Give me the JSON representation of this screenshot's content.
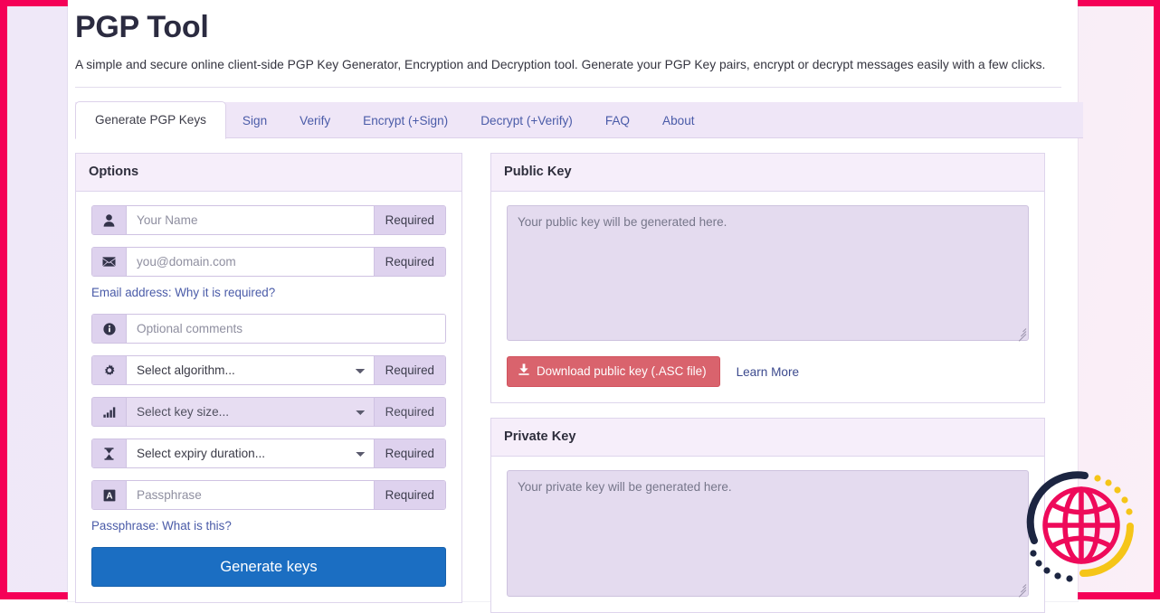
{
  "page": {
    "title": "PGP Tool",
    "subtitle": "A simple and secure online client-side PGP Key Generator, Encryption and Decryption tool. Generate your PGP Key pairs, encrypt or decrypt messages easily with a few clicks.",
    "frame_color": "#f50057",
    "background_color": "#efe8f8"
  },
  "tabs": [
    {
      "label": "Generate PGP Keys",
      "active": true
    },
    {
      "label": "Sign",
      "active": false
    },
    {
      "label": "Verify",
      "active": false
    },
    {
      "label": "Encrypt (+Sign)",
      "active": false
    },
    {
      "label": "Decrypt (+Verify)",
      "active": false
    },
    {
      "label": "FAQ",
      "active": false
    },
    {
      "label": "About",
      "active": false
    }
  ],
  "options_panel": {
    "title": "Options",
    "fields": {
      "name": {
        "icon": "user-icon",
        "placeholder": "Your Name",
        "value": "",
        "addon": "Required"
      },
      "email": {
        "icon": "envelope-icon",
        "placeholder": "you@domain.com",
        "value": "",
        "addon": "Required"
      },
      "email_help": "Email address: Why it is required?",
      "comments": {
        "icon": "info-icon",
        "placeholder": "Optional comments",
        "value": "",
        "addon": ""
      },
      "algorithm": {
        "icon": "gear-icon",
        "placeholder": "Select algorithm...",
        "addon": "Required",
        "disabled": false
      },
      "keysize": {
        "icon": "signal-bars-icon",
        "placeholder": "Select key size...",
        "addon": "Required",
        "disabled": true
      },
      "expiry": {
        "icon": "hourglass-icon",
        "placeholder": "Select expiry duration...",
        "addon": "Required",
        "disabled": false
      },
      "passphrase": {
        "icon": "font-letter-icon",
        "placeholder": "Passphrase",
        "value": "",
        "addon": "Required"
      },
      "passphrase_help": "Passphrase: What is this?"
    },
    "generate_button": "Generate keys",
    "generate_button_color": "#1b6ec2"
  },
  "public_key_panel": {
    "title": "Public Key",
    "textarea_placeholder": "Your public key will be generated here.",
    "textarea_value": "",
    "download_button": "Download public key (.ASC file)",
    "download_button_color": "#d9636d",
    "learn_more": "Learn More"
  },
  "private_key_panel": {
    "title": "Private Key",
    "textarea_placeholder": "Your private key will be generated here.",
    "textarea_value": ""
  },
  "watermark": {
    "icon": "globe-icon",
    "globe_color": "#ee0a5a",
    "arc_dark_color": "#1c2541",
    "arc_yellow_color": "#f5c518"
  }
}
